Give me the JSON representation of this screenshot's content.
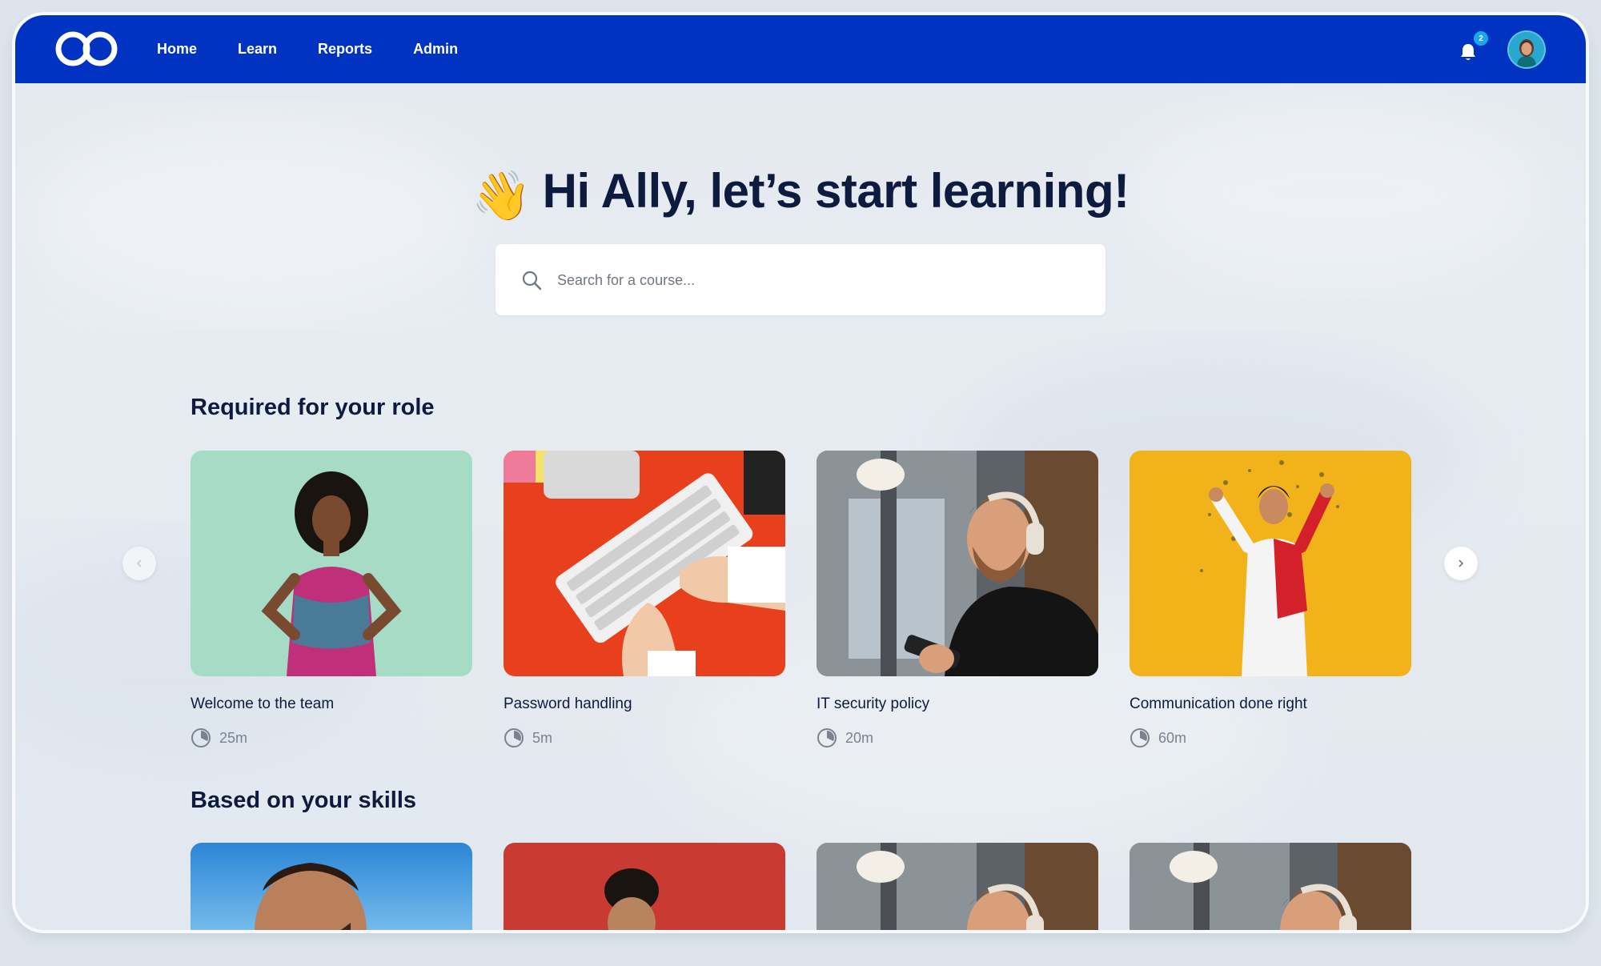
{
  "nav": {
    "logo_name": "infinity-logo",
    "items": [
      {
        "label": "Home"
      },
      {
        "label": "Learn"
      },
      {
        "label": "Reports"
      },
      {
        "label": "Admin"
      }
    ],
    "notification_count": "2"
  },
  "hero": {
    "emoji": "👋",
    "title": "Hi Ally, let’s start learning!"
  },
  "search": {
    "placeholder": "Search for a course..."
  },
  "sections": [
    {
      "title": "Required for your role",
      "courses": [
        {
          "title": "Welcome to the team",
          "duration": "25m"
        },
        {
          "title": "Password handling",
          "duration": "5m"
        },
        {
          "title": "IT security policy",
          "duration": "20m"
        },
        {
          "title": "Communication done right",
          "duration": "60m"
        }
      ]
    },
    {
      "title": "Based on your skills",
      "courses": [
        {
          "title": "",
          "duration": ""
        },
        {
          "title": "",
          "duration": ""
        },
        {
          "title": "",
          "duration": ""
        },
        {
          "title": "",
          "duration": ""
        }
      ]
    }
  ],
  "colors": {
    "brand": "#0033c1",
    "heading": "#0d1b3e",
    "badge": "#19a8ee"
  }
}
